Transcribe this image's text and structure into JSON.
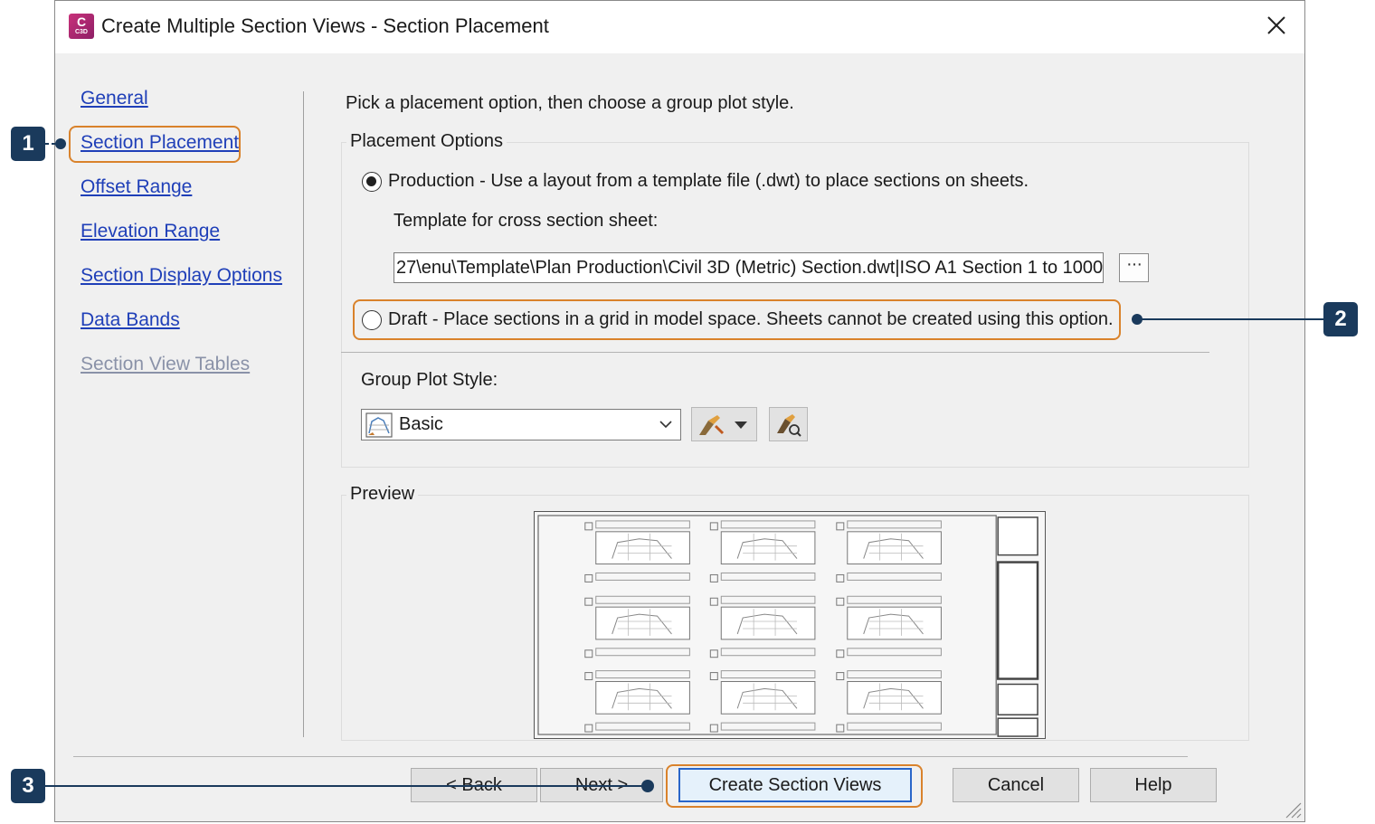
{
  "window": {
    "title": "Create Multiple Section Views - Section Placement",
    "app_icon_letter": "C",
    "app_icon_sub": "C3D",
    "app_icon_color": "#b02a72"
  },
  "nav": {
    "items": [
      {
        "label": "General",
        "enabled": true
      },
      {
        "label": "Section Placement",
        "enabled": true,
        "current": true
      },
      {
        "label": "Offset Range",
        "enabled": true
      },
      {
        "label": "Elevation Range",
        "enabled": true
      },
      {
        "label": "Section Display Options",
        "enabled": true
      },
      {
        "label": "Data Bands",
        "enabled": true
      },
      {
        "label": "Section View Tables",
        "enabled": false
      }
    ]
  },
  "main": {
    "instruction": "Pick a placement option, then choose a group plot style.",
    "placement": {
      "legend": "Placement Options",
      "production_label": "Production - Use a layout from a template file (.dwt) to place sections on sheets.",
      "production_selected": true,
      "template_label": "Template for cross section sheet:",
      "template_value": "27\\enu\\Template\\Plan Production\\Civil 3D (Metric) Section.dwt|ISO A1 Section 1 to 1000",
      "browse_label": "···",
      "draft_label": "Draft - Place sections in a grid in model space. Sheets cannot be created using this option.",
      "draft_selected": false
    },
    "group_plot_style": {
      "label": "Group Plot Style:",
      "value": "Basic"
    },
    "preview": {
      "legend": "Preview"
    }
  },
  "buttons": {
    "back": "< Back",
    "next": "Next >",
    "create": "Create Section Views",
    "cancel": "Cancel",
    "help": "Help"
  },
  "callouts": [
    "1",
    "2",
    "3"
  ],
  "colors": {
    "callout": "#1a3a5c",
    "highlight": "#d9822b",
    "link": "#1f3fb8",
    "primary_border": "#2a66c9"
  }
}
